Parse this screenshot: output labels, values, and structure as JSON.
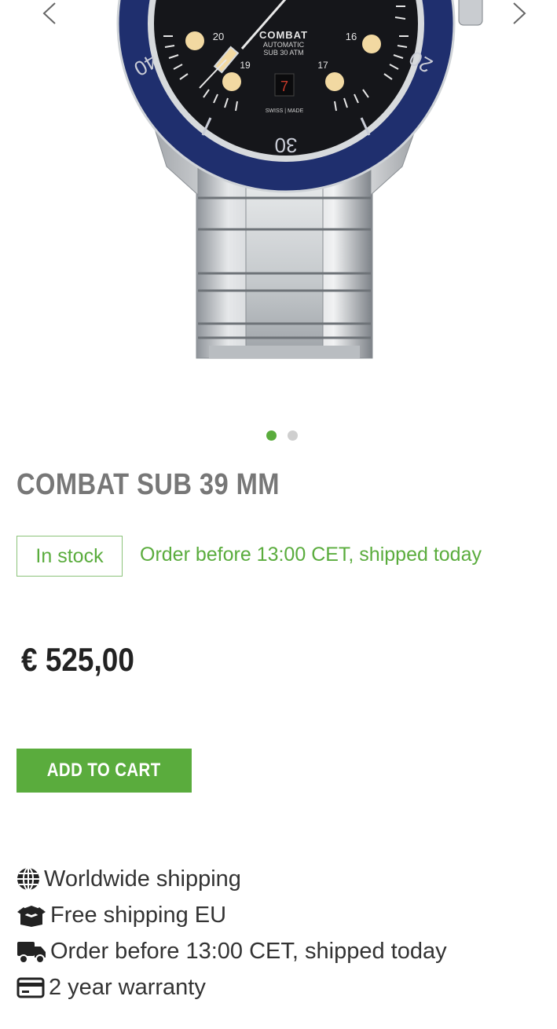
{
  "gallery": {
    "image_alt": "Combat Sub 39 mm watch",
    "dial_texts": {
      "brand": "COMBAT",
      "line2": "AUTOMATIC",
      "line3": "SUB 30 ATM",
      "date": "7",
      "swiss": "SWISS | MADE",
      "n20": "20",
      "n19": "19",
      "n16": "16",
      "n17": "17",
      "bezel40": "40",
      "bezel20": "20",
      "bezel30": "30"
    },
    "total_slides": 2,
    "active_slide": 1
  },
  "product": {
    "title": "COMBAT SUB 39 MM",
    "stock_label": "In stock",
    "shipping_note": "Order before 13:00 CET, shipped today",
    "price": "€ 525,00",
    "add_to_cart_label": "ADD TO CART"
  },
  "features": [
    {
      "icon": "globe-icon",
      "label": "Worldwide shipping"
    },
    {
      "icon": "box-icon",
      "label": "Free shipping EU"
    },
    {
      "icon": "truck-icon",
      "label": "Order before 13:00 CET, shipped today"
    },
    {
      "icon": "credit-card-icon",
      "label": "2 year warranty"
    }
  ],
  "colors": {
    "accent": "#5aac3d",
    "title_gray": "#777777",
    "bezel_blue": "#1f2f6e",
    "dial_black": "#15161a"
  }
}
